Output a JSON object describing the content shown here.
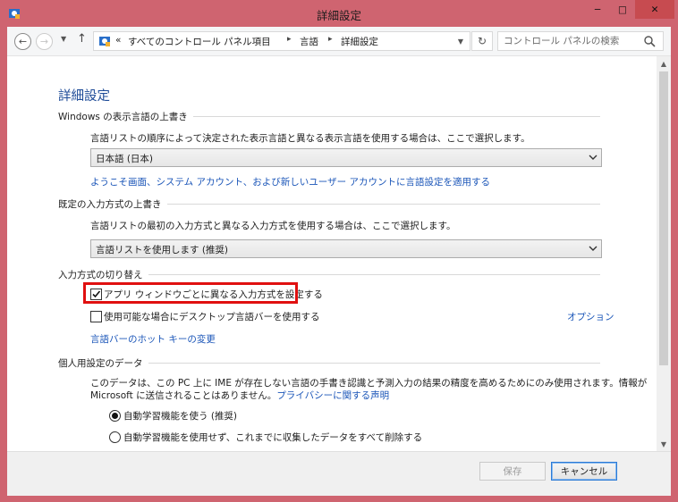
{
  "window": {
    "title": "詳細設定",
    "controls": {
      "minimize": "─",
      "maximize": "□",
      "close": "✕"
    }
  },
  "address_bar": {
    "overflow": "«",
    "breadcrumb": [
      "すべてのコントロール パネル項目",
      "言語",
      "詳細設定"
    ],
    "search_placeholder": "コントロール パネルの検索"
  },
  "page": {
    "title": "詳細設定",
    "sections": {
      "display_language": {
        "header": "Windows の表示言語の上書き",
        "description": "言語リストの順序によって決定された表示言語と異なる表示言語を使用する場合は、ここで選択します。",
        "selected": "日本語 (日本)",
        "link": "ようこそ画面、システム アカウント、および新しいユーザー アカウントに言語設定を適用する"
      },
      "input_method": {
        "header": "既定の入力方式の上書き",
        "description": "言語リストの最初の入力方式と異なる入力方式を使用する場合は、ここで選択します。",
        "selected": "言語リストを使用します (推奨)"
      },
      "switching": {
        "header": "入力方式の切り替え",
        "per_app_checkbox": {
          "label": "アプリ ウィンドウごとに異なる入力方式を設定する",
          "checked": true
        },
        "desktop_bar_checkbox": {
          "label": "使用可能な場合にデスクトップ言語バーを使用する",
          "checked": false
        },
        "options_link": "オプション",
        "hotkey_link": "言語バーのホット キーの変更"
      },
      "personalization": {
        "header": "個人用設定のデータ",
        "description_line1": "このデータは、この PC 上に IME が存在しない言語の手書き認識と予測入力の結果の精度を高めるためにのみ使用されます。情報が",
        "description_line2": "Microsoft に送信されることはありません。",
        "privacy_link": "プライバシーに関する声明",
        "radio_use": {
          "label": "自動学習機能を使う (推奨)",
          "selected": true
        },
        "radio_dont_use": {
          "label": "自動学習機能を使用せず、これまでに収集したデータをすべて削除する",
          "selected": false
        }
      }
    }
  },
  "footer": {
    "save": "保存",
    "cancel": "キャンセル"
  },
  "colors": {
    "titlebar": "#cf6470",
    "accent_title": "#1f4c98",
    "link": "#1a55b8",
    "highlight": "#e01010"
  }
}
